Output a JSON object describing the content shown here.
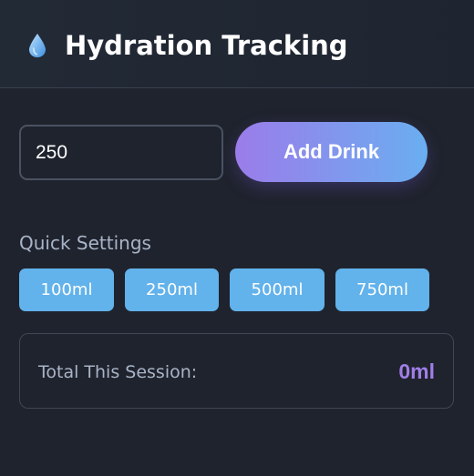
{
  "header": {
    "icon": "water-drop-icon",
    "title": "Hydration Tracking"
  },
  "entry": {
    "amount_value": "250",
    "add_label": "Add Drink"
  },
  "quick_settings": {
    "label": "Quick Settings",
    "options": [
      "100ml",
      "250ml",
      "500ml",
      "750ml"
    ]
  },
  "summary": {
    "label": "Total This Session:",
    "value": "0ml"
  },
  "colors": {
    "background": "#1f232d",
    "accent_purple": "#9b7cea",
    "accent_blue": "#62b2eb",
    "total_value": "#a07ee8"
  }
}
